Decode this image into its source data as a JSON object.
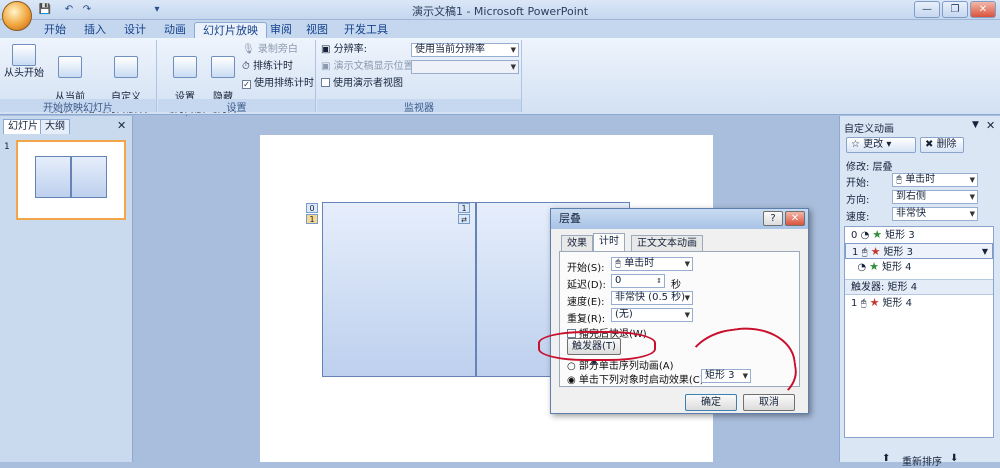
{
  "window": {
    "title": "演示文稿1 - Microsoft PowerPoint",
    "controls": [
      "—",
      "❐",
      "✕"
    ]
  },
  "quick_access": [
    "💾",
    "↶",
    "↷",
    "▾"
  ],
  "ribbon_tabs": [
    "开始",
    "插入",
    "设计",
    "动画",
    "幻灯片放映",
    "审阅",
    "视图",
    "开发工具"
  ],
  "ribbon": {
    "from_start": "从头开始",
    "from_current": "从当前\n幻灯片开始",
    "custom_show": "自定义\n幻灯片放映 ▾",
    "group1": "开始放映幻灯片",
    "setup_show": "设置\n幻灯片放映",
    "hide_slide": "隐藏\n幻灯片",
    "record_narration": "录制旁白",
    "rehearse_timings": "排练计时",
    "use_timings": "使用排练计时",
    "group2": "设置",
    "resolution_label": "分辨率:",
    "resolution_value": "使用当前分辨率",
    "show_on_label": "演示文稿显示位置:",
    "presenter_view": "使用演示者视图",
    "group3": "监视器"
  },
  "left_pane": {
    "tab_slides": "幻灯片",
    "tab_outline": "大纲",
    "slide_number": "1",
    "close": "✕"
  },
  "slide": {
    "tag0": "0",
    "tag1": "1",
    "tag_right": "1"
  },
  "animation_pane": {
    "title": "自定义动画",
    "change_btn": "更改",
    "remove_btn": "删除",
    "modify_label": "修改: 层叠",
    "start_label": "开始:",
    "start_value": "单击时",
    "direction_label": "方向:",
    "direction_value": "到右侧",
    "speed_label": "速度:",
    "speed_value": "非常快",
    "items": [
      {
        "num": "0",
        "name": "矩形 3"
      },
      {
        "num": "1",
        "name": "矩形 3"
      },
      {
        "num": "",
        "name": "矩形 4"
      }
    ],
    "trigger_label": "触发器: 矩形 4",
    "trigger_item": {
      "num": "1",
      "name": "矩形 4"
    },
    "reorder": "重新排序"
  },
  "dialog": {
    "title": "层叠",
    "tabs": [
      "效果",
      "计时",
      "正文文本动画"
    ],
    "start_label": "开始(S):",
    "start_value": "单击时",
    "delay_label": "延迟(D):",
    "delay_value": "0",
    "delay_unit": "秒",
    "speed_label": "速度(E):",
    "speed_value": "非常快 (0.5 秒)",
    "repeat_label": "重复(R):",
    "repeat_value": "(无)",
    "rewind_label": "播完后快退(W)",
    "trigger_btn": "触发器(T)",
    "option1": "部分单击序列动画(A)",
    "option2": "单击下列对象时启动效果(C):",
    "object_value": "矩形 3",
    "ok": "确定",
    "cancel": "取消"
  }
}
